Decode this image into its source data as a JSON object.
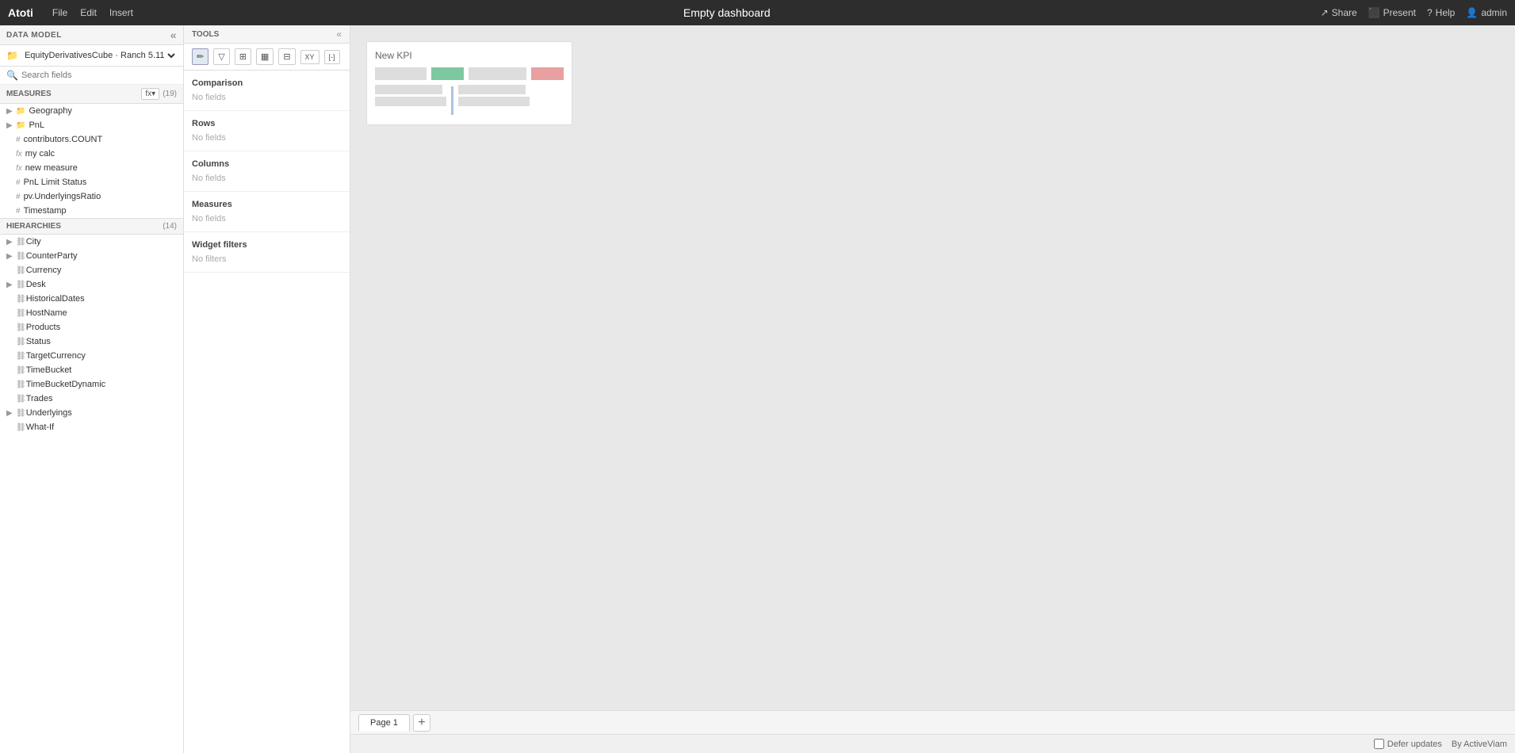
{
  "app": {
    "logo": "Atoti",
    "menu": [
      "File",
      "Edit",
      "Insert"
    ],
    "title": "Empty dashboard",
    "right_menu": [
      {
        "label": "Share",
        "icon": "share"
      },
      {
        "label": "Present",
        "icon": "present"
      },
      {
        "label": "Help",
        "icon": "help"
      },
      {
        "label": "admin",
        "icon": "user"
      }
    ]
  },
  "data_model": {
    "section_label": "DATA MODEL",
    "cube_name": "EquityDerivativesCube",
    "cube_version": "Ranch 5.11"
  },
  "search": {
    "placeholder": "Search fields",
    "value": ""
  },
  "measures": {
    "section_label": "MEASURES",
    "count": "(19)",
    "items": [
      {
        "type": "folder",
        "name": "Geography",
        "expandable": true
      },
      {
        "type": "folder",
        "name": "PnL",
        "expandable": true
      },
      {
        "type": "hash",
        "name": "contributors.COUNT"
      },
      {
        "type": "fx",
        "name": "my calc"
      },
      {
        "type": "fx",
        "name": "new measure"
      },
      {
        "type": "hash",
        "name": "PnL Limit Status"
      },
      {
        "type": "hash",
        "name": "pv.UnderlyingsRatio"
      },
      {
        "type": "hash",
        "name": "Timestamp"
      }
    ]
  },
  "hierarchies": {
    "section_label": "HIERARCHIES",
    "count": "(14)",
    "items": [
      "City",
      "CounterParty",
      "Currency",
      "Desk",
      "HistoricalDates",
      "HostName",
      "Products",
      "Status",
      "TargetCurrency",
      "TimeBucket",
      "TimeBucketDynamic",
      "Trades",
      "Underlyings",
      "What-If"
    ]
  },
  "tools": {
    "section_label": "TOOLS",
    "chart_buttons": [
      {
        "icon": "✏",
        "label": "edit"
      },
      {
        "icon": "▽",
        "label": "filter"
      },
      {
        "icon": "⊞",
        "label": "layout"
      },
      {
        "icon": "▦",
        "label": "bar-chart"
      },
      {
        "icon": "⊟",
        "label": "table"
      },
      {
        "icon": "xy",
        "label": "xy-chart"
      },
      {
        "icon": "[-]",
        "label": "range"
      }
    ],
    "sections": [
      {
        "label": "Comparison",
        "empty_text": "No fields"
      },
      {
        "label": "Rows",
        "empty_text": "No fields"
      },
      {
        "label": "Columns",
        "empty_text": "No fields"
      },
      {
        "label": "Measures",
        "empty_text": "No fields"
      },
      {
        "label": "Widget filters",
        "empty_text": "No filters"
      }
    ]
  },
  "dashboard": {
    "new_kpi_label": "New KPI"
  },
  "pages": [
    {
      "label": "Page 1",
      "active": true
    }
  ],
  "add_page_label": "+",
  "bottom_bar": {
    "defer_label": "Defer updates",
    "brand_label": "By ActiveViam"
  }
}
